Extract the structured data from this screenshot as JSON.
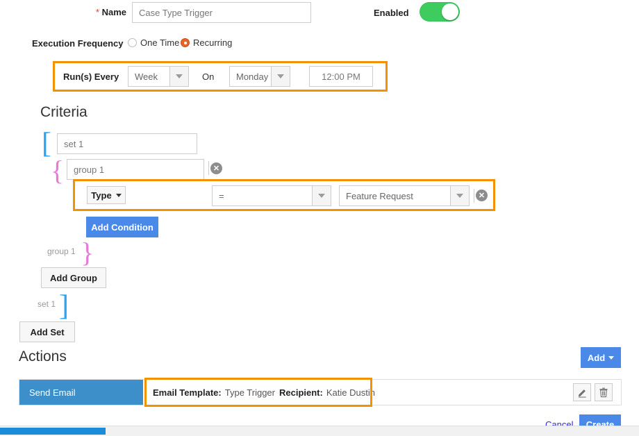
{
  "form": {
    "name_label": "Name",
    "required_mark": "*",
    "name_value": "Case Type Trigger",
    "enabled_label": "Enabled",
    "execution_frequency_label": "Execution Frequency",
    "frequency_options": [
      {
        "label": "One Time",
        "selected": false
      },
      {
        "label": "Recurring",
        "selected": true
      }
    ],
    "runs_every_label": "Run(s) Every",
    "runs_every_value": "Week",
    "on_label": "On",
    "on_value": "Monday",
    "time_value": "12:00 PM"
  },
  "criteria": {
    "heading": "Criteria",
    "set_name": "set 1",
    "group_name": "group 1",
    "condition": {
      "field": "Type",
      "operator": "=",
      "value": "Feature Request"
    },
    "add_condition_label": "Add Condition",
    "group_close_label": "group 1",
    "add_group_label": "Add Group",
    "set_close_label": "set 1",
    "add_set_label": "Add Set"
  },
  "actions": {
    "heading": "Actions",
    "add_label": "Add",
    "rows": [
      {
        "type": "Send Email",
        "detail_label_1": "Email Template:",
        "detail_value_1": "Type Trigger",
        "detail_label_2": "Recipient:",
        "detail_value_2": "Katie Dustin"
      }
    ]
  },
  "footer": {
    "cancel_label": "Cancel",
    "create_label": "Create"
  },
  "icons": {
    "remove_group": "x-circle-icon",
    "remove_condition": "x-circle-icon",
    "edit": "pencil-icon",
    "delete": "trash-icon",
    "dropdown": "chevron-down-icon"
  },
  "colors": {
    "highlight": "#f39200",
    "primary": "#4a89e8",
    "toggle_on": "#3ecc5f",
    "action_blue": "#3d8fc9",
    "bracket_square": "#2ca4f5",
    "bracket_curly": "#e87ad8"
  }
}
